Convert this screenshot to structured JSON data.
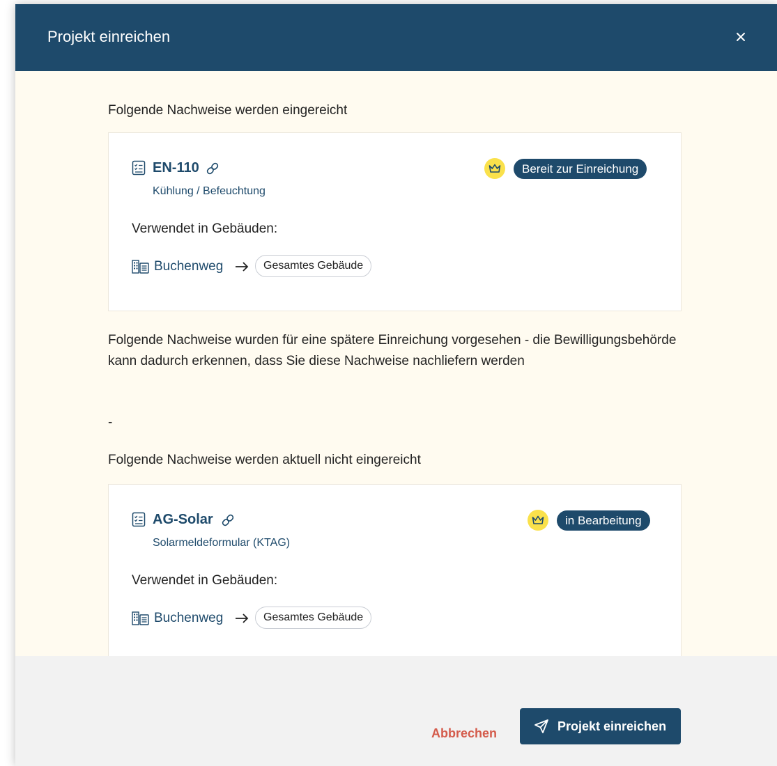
{
  "modal": {
    "title": "Projekt einreichen",
    "close_icon": "close-icon"
  },
  "sections": {
    "submitted_heading": "Folgende Nachweise werden eingereicht",
    "later_heading": "Folgende Nachweise wurden für eine spätere Einreichung vorgesehen - die Bewilligungsbehörde kann dadurch erkennen, dass Sie diese Nachweise nachliefern werden",
    "later_placeholder": "-",
    "not_submitted_heading": "Folgende Nachweise werden aktuell nicht eingereicht"
  },
  "cards": [
    {
      "code": "EN-110",
      "subtitle": "Kühlung / Befeuchtung",
      "status": "Bereit zur Einreichung",
      "used_label": "Verwendet in Gebäuden:",
      "building": "Buchenweg",
      "arrow": "→",
      "scope": "Gesamtes Gebäude",
      "icons": [
        "document-checklist-icon",
        "link-icon",
        "crown-icon",
        "building-icon",
        "arrow-right-icon"
      ]
    },
    {
      "code": "AG-Solar",
      "subtitle": "Solarmeldeformular (KTAG)",
      "status": "in Bearbeitung",
      "used_label": "Verwendet in Gebäuden:",
      "building": "Buchenweg",
      "arrow": "→",
      "scope": "Gesamtes Gebäude",
      "icons": [
        "document-checklist-icon",
        "link-icon",
        "crown-icon",
        "building-icon",
        "arrow-right-icon"
      ]
    }
  ],
  "footer": {
    "cancel_label": "Abbrechen",
    "submit_label": "Projekt einreichen",
    "submit_icon": "send-icon"
  },
  "colors": {
    "primary": "#1e4a6b",
    "background": "#fffbf0",
    "accent_yellow": "#fae14b",
    "cancel_red": "#d45b4b",
    "footer_bg": "#f2f2f2"
  }
}
